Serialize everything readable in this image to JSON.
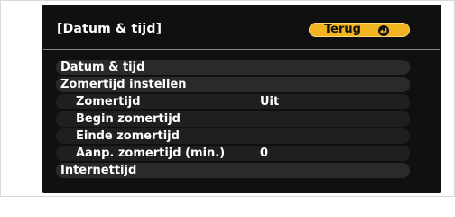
{
  "menu": {
    "title": "[Datum & tijd]",
    "back_label": "Terug",
    "back_icon": "enter-icon",
    "items": [
      {
        "label": "Datum & tijd",
        "value": ""
      },
      {
        "label": "Zomertijd instellen",
        "value": ""
      },
      {
        "label": "Zomertijd",
        "value": "Uit"
      },
      {
        "label": "Begin zomertijd",
        "value": ""
      },
      {
        "label": "Einde zomertijd",
        "value": ""
      },
      {
        "label": "Aanp. zomertijd (min.)",
        "value": "0"
      },
      {
        "label": "Internettijd",
        "value": ""
      }
    ]
  },
  "colors": {
    "background": "#101010",
    "accent": "#f2b320",
    "text": "#ffffff"
  }
}
